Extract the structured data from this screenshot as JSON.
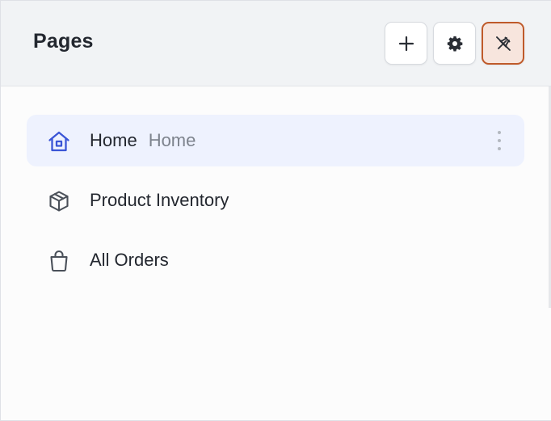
{
  "header": {
    "title": "Pages",
    "buttons": {
      "add": {
        "icon": "plus-icon"
      },
      "settings": {
        "icon": "gear-icon"
      },
      "unpin": {
        "icon": "pin-off-icon",
        "active": true
      }
    }
  },
  "pages": [
    {
      "label": "Home",
      "sublabel": "Home",
      "icon": "home-icon",
      "selected": true
    },
    {
      "label": "Product Inventory",
      "icon": "box-icon",
      "selected": false
    },
    {
      "label": "All Orders",
      "icon": "shopping-bag-icon",
      "selected": false
    }
  ],
  "colors": {
    "accent": "#3a55d6",
    "selected_bg": "#eef2fe",
    "active_border": "#bf5a2a",
    "active_bg": "#f7e5dd",
    "text": "#23272f",
    "muted_text": "#7d838d"
  }
}
